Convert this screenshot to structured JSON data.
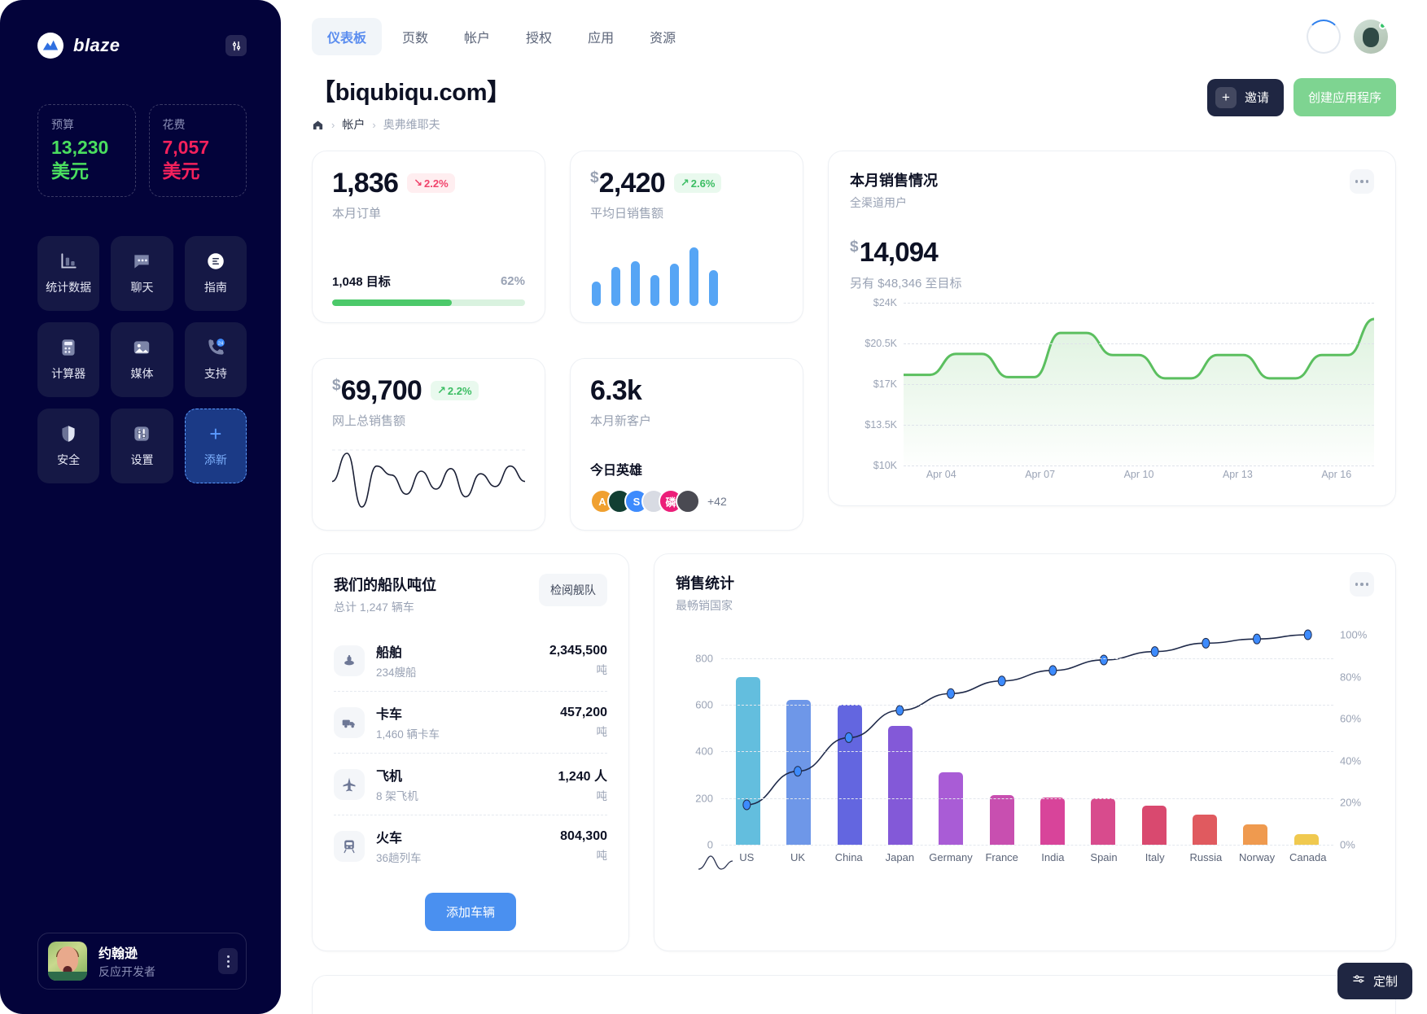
{
  "sidebar": {
    "brand": "blaze",
    "brand_logo_icon": "blaze-mountain-logo",
    "head_button_icon": "sliders-icon",
    "kpis": [
      {
        "label": "预算",
        "value": "13,230 美元",
        "color": "#4ade5f",
        "name": "budget"
      },
      {
        "label": "花费",
        "value": "7,057 美元",
        "color": "#f4215c",
        "name": "spend"
      }
    ],
    "tiles": [
      {
        "label": "统计数据",
        "icon": "bar-chart-icon"
      },
      {
        "label": "聊天",
        "icon": "chat-bubble-icon"
      },
      {
        "label": "指南",
        "icon": "compass-icon"
      },
      {
        "label": "计算器",
        "icon": "calculator-icon"
      },
      {
        "label": "媒体",
        "icon": "image-icon"
      },
      {
        "label": "支持",
        "icon": "phone-24-icon"
      },
      {
        "label": "安全",
        "icon": "shield-icon"
      },
      {
        "label": "设置",
        "icon": "sliders-icon"
      },
      {
        "label": "添新",
        "icon": "plus-icon"
      }
    ],
    "profile": {
      "name": "约翰逊",
      "role": "反应开发者",
      "avatar": "user-avatar",
      "menu_icon": "kebab-menu-icon"
    }
  },
  "topbar": {
    "tabs": [
      {
        "label": "仪表板",
        "active": true
      },
      {
        "label": "页数",
        "active": false
      },
      {
        "label": "帐户",
        "active": false
      },
      {
        "label": "授权",
        "active": false
      },
      {
        "label": "应用",
        "active": false
      },
      {
        "label": "资源",
        "active": false
      }
    ],
    "spinner_icon": "loading-spinner-icon",
    "account_avatar_icon": "account-avatar"
  },
  "pagehead": {
    "title": "【biqubiqu.com】",
    "breadcrumb": {
      "home_icon": "home-icon",
      "items": [
        "帐户",
        "奥弗维耶夫"
      ]
    },
    "invite_label": "邀请",
    "create_label": "创建应用程序"
  },
  "cards": {
    "orders": {
      "value": "1,836",
      "delta": "2.2%",
      "delta_dir": "down",
      "subtitle": "本月订单",
      "goal_label": "1,048 目标",
      "goal_percent": "62%",
      "progress": 62
    },
    "avg_daily": {
      "currency": "$",
      "value": "2,420",
      "delta": "2.6%",
      "delta_dir": "up",
      "subtitle": "平均日销售额",
      "bars": [
        30,
        48,
        55,
        38,
        52,
        72,
        44
      ]
    },
    "online_sales": {
      "currency": "$",
      "value": "69,700",
      "delta": "2.2%",
      "delta_dir": "up",
      "subtitle": "网上总销售额"
    },
    "new_customers": {
      "value": "6.3k",
      "subtitle": "本月新客户",
      "heroes_title": "今日英雄",
      "heroes": [
        {
          "initial": "A",
          "color": "#f0a030"
        },
        {
          "initial": "",
          "color": "#123f33"
        },
        {
          "initial": "S",
          "color": "#3d8bfd"
        },
        {
          "initial": "",
          "color": "#d8dbe3"
        },
        {
          "initial": "磷",
          "color": "#ec1e79"
        },
        {
          "initial": "",
          "color": "#4a4a52"
        }
      ],
      "more": "+42"
    },
    "monthly_sales": {
      "title": "本月销售情况",
      "subtitle": "全渠道用户",
      "currency": "$",
      "value": "14,094",
      "note": "另有 $48,346 至目标",
      "menu_icon": "kebab-menu-icon"
    },
    "fleet": {
      "title": "我们的船队吨位",
      "subtitle": "总计 1,247 辆车",
      "review_label": "检阅舰队",
      "rows": [
        {
          "icon": "ship-icon",
          "name": "船舶",
          "sub": "234艘船",
          "value": "2,345,500",
          "unit": "吨"
        },
        {
          "icon": "truck-icon",
          "name": "卡车",
          "sub": "1,460 辆卡车",
          "value": "457,200",
          "unit": "吨"
        },
        {
          "icon": "plane-icon",
          "name": "飞机",
          "sub": "8 架飞机",
          "value": "1,240 人",
          "unit": "吨"
        },
        {
          "icon": "train-icon",
          "name": "火车",
          "sub": "36趟列车",
          "value": "804,300",
          "unit": "吨"
        }
      ],
      "add_label": "添加车辆"
    },
    "sales_stats": {
      "title": "销售统计",
      "subtitle": "最畅销国家",
      "menu_icon": "kebab-menu-icon",
      "legend_icon": "bell-curve-icon"
    }
  },
  "chart_data": [
    {
      "type": "area",
      "name": "monthly-sales-area",
      "title": "本月销售情况",
      "subtitle": "全渠道用户",
      "xlabel": "",
      "ylabel": "",
      "ylim": [
        10000,
        24000
      ],
      "yticks": [
        24000,
        20500,
        17000,
        13500,
        10000
      ],
      "ytick_labels": [
        "$24K",
        "$20.5K",
        "$17K",
        "$13.5K",
        "$10K"
      ],
      "xtick_labels": [
        "Apr 04",
        "Apr 07",
        "Apr 10",
        "Apr 13",
        "Apr 16"
      ],
      "grid": true,
      "line_color": "#5bbf5f",
      "values": [
        17800,
        17800,
        19600,
        19600,
        17600,
        17600,
        21400,
        21400,
        19500,
        19500,
        17500,
        17500,
        19500,
        19500,
        17500,
        17500,
        19500,
        19500,
        22600
      ]
    },
    {
      "type": "bar",
      "name": "avg-daily-minibars",
      "title": "平均日销售额",
      "categories": [
        "1",
        "2",
        "3",
        "4",
        "5",
        "6",
        "7"
      ],
      "values": [
        30,
        48,
        55,
        38,
        52,
        72,
        44
      ],
      "bar_color": "#56a5f5",
      "grid": false
    },
    {
      "type": "line",
      "name": "online-sales-sparkline",
      "title": "网上总销售额",
      "values": [
        50,
        72,
        30,
        62,
        55,
        40,
        58,
        44,
        60,
        38,
        56,
        46,
        62,
        50
      ],
      "line_color": "#1a1f35",
      "grid": false
    },
    {
      "type": "bar",
      "name": "sales-statistics-pareto",
      "title": "销售统计",
      "subtitle": "最畅销国家",
      "categories": [
        "US",
        "UK",
        "China",
        "Japan",
        "Germany",
        "France",
        "India",
        "Spain",
        "Italy",
        "Russia",
        "Norway",
        "Canada"
      ],
      "values": [
        720,
        622,
        600,
        510,
        310,
        212,
        202,
        198,
        168,
        130,
        88,
        45
      ],
      "ylabel": "",
      "ylim": [
        0,
        900
      ],
      "yticks": [
        0,
        200,
        400,
        600,
        800
      ],
      "ytick_labels": [
        "0",
        "200",
        "400",
        "600",
        "800"
      ],
      "secondary_axis": {
        "name": "cumulative-percent",
        "ticks": [
          0,
          20,
          40,
          60,
          80,
          100
        ],
        "tick_labels": [
          "0%",
          "20%",
          "40%",
          "60%",
          "80%",
          "100%"
        ],
        "values": [
          19,
          35,
          51,
          64,
          72,
          78,
          83,
          88,
          92,
          96,
          98,
          100
        ],
        "line_color": "#1f2a4a",
        "marker_color": "#3d8bfd"
      },
      "bar_colors": [
        "#63bede",
        "#6e97e8",
        "#6366e0",
        "#8359d8",
        "#a95cd6",
        "#c84fb0",
        "#d8449a",
        "#d84b8d",
        "#d9496f",
        "#e05a5f",
        "#ef9a4f",
        "#f0c94f"
      ],
      "grid": true
    }
  ],
  "customize": {
    "label": "定制",
    "icon": "sliders-icon"
  }
}
